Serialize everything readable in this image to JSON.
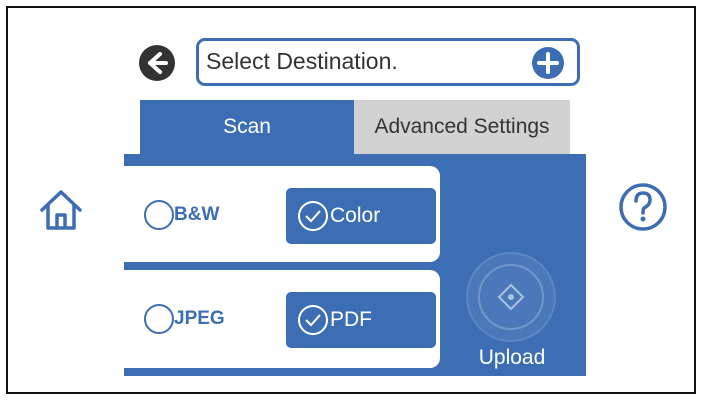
{
  "header": {
    "destination_placeholder": "Select Destination.",
    "back_icon": "arrow-left-circle-icon",
    "add_icon": "plus-circle-icon"
  },
  "tabs": [
    {
      "label": "Scan",
      "active": true
    },
    {
      "label": "Advanced Settings",
      "active": false
    }
  ],
  "color_mode": {
    "options": [
      {
        "label": "B&W",
        "selected": false
      },
      {
        "label": "Color",
        "selected": true
      }
    ]
  },
  "file_format": {
    "options": [
      {
        "label": "JPEG",
        "selected": false
      },
      {
        "label": "PDF",
        "selected": true
      }
    ]
  },
  "upload": {
    "label": "Upload",
    "icon": "start-diamond-icon"
  },
  "side": {
    "home_icon": "home-icon",
    "help_icon": "help-icon"
  },
  "colors": {
    "accent": "#3d6eb4",
    "tab_inactive": "#d2d2d2",
    "text_dark": "#333333"
  }
}
